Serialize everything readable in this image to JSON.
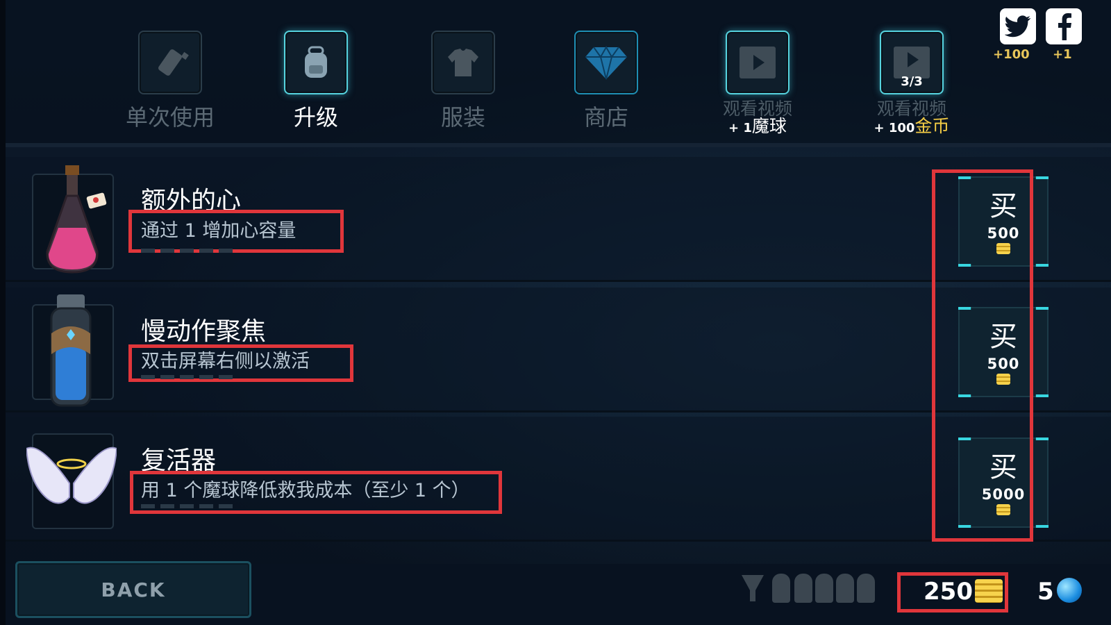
{
  "tabs": [
    {
      "label": "单次使用",
      "icon": "bottle-icon",
      "active": false
    },
    {
      "label": "升级",
      "icon": "backpack-icon",
      "active": true
    },
    {
      "label": "服装",
      "icon": "shirt-icon",
      "active": false
    },
    {
      "label": "商店",
      "icon": "diamond-icon",
      "active": false
    },
    {
      "label": "观看视频",
      "reward_amount": "+ 1",
      "reward_unit": "魔球",
      "icon": "video-play-icon"
    },
    {
      "label": "观看视频",
      "reward_amount": "+ 100",
      "reward_unit": "金币",
      "badge": "3/3",
      "icon": "video-play-icon"
    }
  ],
  "social": {
    "twitter_reward": "+100",
    "facebook_reward": "+1"
  },
  "items": [
    {
      "name": "额外的心",
      "description": "通过 1 增加心容量",
      "buy_label": "买",
      "price": "500",
      "icon": "heart-potion-icon"
    },
    {
      "name": "慢动作聚焦",
      "description": "双击屏幕右侧以激活",
      "buy_label": "买",
      "price": "500",
      "icon": "blue-flask-icon"
    },
    {
      "name": "复活器",
      "description": "用 1 个魔球降低救我成本（至少 1 个）",
      "buy_label": "买",
      "price": "5000",
      "icon": "angel-wings-icon"
    }
  ],
  "bottom": {
    "back_label": "BACK",
    "coins": "250",
    "orbs": "5"
  },
  "colors": {
    "highlight": "#e0363b",
    "accent": "#38d6e0",
    "gold": "#f3cc45"
  }
}
